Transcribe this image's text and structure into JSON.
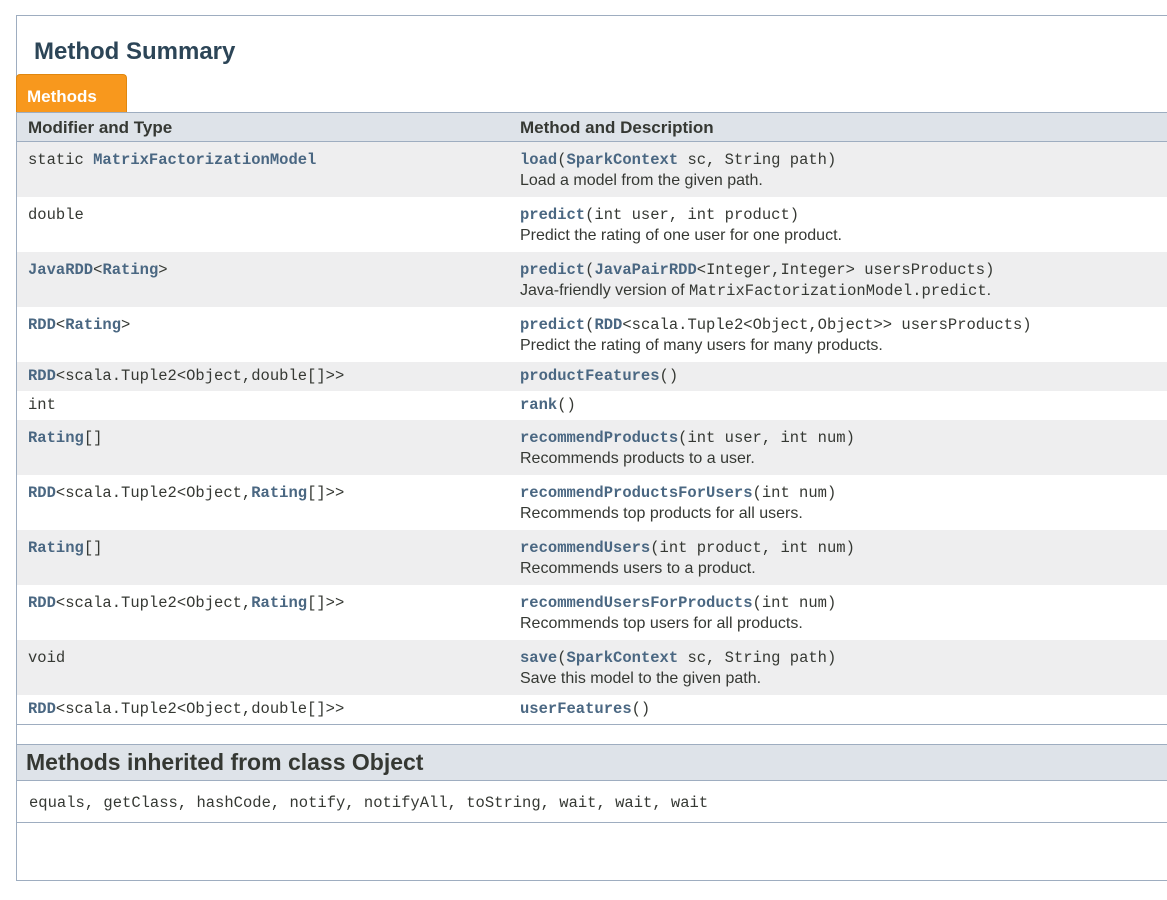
{
  "section_title": "Method Summary",
  "tab_label": "Methods",
  "headers": {
    "modifier": "Modifier and Type",
    "method": "Method and Description"
  },
  "rows": [
    {
      "type": [
        {
          "t": "static ",
          "link": false
        },
        {
          "t": "MatrixFactorizationModel",
          "link": true
        }
      ],
      "sig": [
        {
          "t": "load",
          "link": true
        },
        {
          "t": "(",
          "link": false
        },
        {
          "t": "SparkContext",
          "link": true
        },
        {
          "t": " sc, String path)",
          "link": false
        }
      ],
      "desc": [
        {
          "t": "Load a model from the given path.",
          "code": false
        }
      ]
    },
    {
      "type": [
        {
          "t": "double",
          "link": false
        }
      ],
      "sig": [
        {
          "t": "predict",
          "link": true
        },
        {
          "t": "(int user, int product)",
          "link": false
        }
      ],
      "desc": [
        {
          "t": "Predict the rating of one user for one product.",
          "code": false
        }
      ]
    },
    {
      "type": [
        {
          "t": "JavaRDD",
          "link": true
        },
        {
          "t": "<",
          "link": false
        },
        {
          "t": "Rating",
          "link": true
        },
        {
          "t": ">",
          "link": false
        }
      ],
      "sig": [
        {
          "t": "predict",
          "link": true
        },
        {
          "t": "(",
          "link": false
        },
        {
          "t": "JavaPairRDD",
          "link": true
        },
        {
          "t": "<Integer,Integer> usersProducts)",
          "link": false
        }
      ],
      "desc": [
        {
          "t": "Java-friendly version of ",
          "code": false
        },
        {
          "t": "MatrixFactorizationModel.predict",
          "code": true
        },
        {
          "t": ".",
          "code": false
        }
      ]
    },
    {
      "type": [
        {
          "t": "RDD",
          "link": true
        },
        {
          "t": "<",
          "link": false
        },
        {
          "t": "Rating",
          "link": true
        },
        {
          "t": ">",
          "link": false
        }
      ],
      "sig": [
        {
          "t": "predict",
          "link": true
        },
        {
          "t": "(",
          "link": false
        },
        {
          "t": "RDD",
          "link": true
        },
        {
          "t": "<scala.Tuple2<Object,Object>> usersProducts)",
          "link": false
        }
      ],
      "desc": [
        {
          "t": "Predict the rating of many users for many products.",
          "code": false
        }
      ]
    },
    {
      "type": [
        {
          "t": "RDD",
          "link": true
        },
        {
          "t": "<scala.Tuple2<Object,double[]>>",
          "link": false
        }
      ],
      "sig": [
        {
          "t": "productFeatures",
          "link": true
        },
        {
          "t": "()",
          "link": false
        }
      ],
      "desc": []
    },
    {
      "type": [
        {
          "t": "int",
          "link": false
        }
      ],
      "sig": [
        {
          "t": "rank",
          "link": true
        },
        {
          "t": "()",
          "link": false
        }
      ],
      "desc": []
    },
    {
      "type": [
        {
          "t": "Rating",
          "link": true
        },
        {
          "t": "[]",
          "link": false
        }
      ],
      "sig": [
        {
          "t": "recommendProducts",
          "link": true
        },
        {
          "t": "(int user, int num)",
          "link": false
        }
      ],
      "desc": [
        {
          "t": "Recommends products to a user.",
          "code": false
        }
      ]
    },
    {
      "type": [
        {
          "t": "RDD",
          "link": true
        },
        {
          "t": "<scala.Tuple2<Object,",
          "link": false
        },
        {
          "t": "Rating",
          "link": true
        },
        {
          "t": "[]>>",
          "link": false
        }
      ],
      "sig": [
        {
          "t": "recommendProductsForUsers",
          "link": true
        },
        {
          "t": "(int num)",
          "link": false
        }
      ],
      "desc": [
        {
          "t": "Recommends top products for all users.",
          "code": false
        }
      ]
    },
    {
      "type": [
        {
          "t": "Rating",
          "link": true
        },
        {
          "t": "[]",
          "link": false
        }
      ],
      "sig": [
        {
          "t": "recommendUsers",
          "link": true
        },
        {
          "t": "(int product, int num)",
          "link": false
        }
      ],
      "desc": [
        {
          "t": "Recommends users to a product.",
          "code": false
        }
      ]
    },
    {
      "type": [
        {
          "t": "RDD",
          "link": true
        },
        {
          "t": "<scala.Tuple2<Object,",
          "link": false
        },
        {
          "t": "Rating",
          "link": true
        },
        {
          "t": "[]>>",
          "link": false
        }
      ],
      "sig": [
        {
          "t": "recommendUsersForProducts",
          "link": true
        },
        {
          "t": "(int num)",
          "link": false
        }
      ],
      "desc": [
        {
          "t": "Recommends top users for all products.",
          "code": false
        }
      ]
    },
    {
      "type": [
        {
          "t": "void",
          "link": false
        }
      ],
      "sig": [
        {
          "t": "save",
          "link": true
        },
        {
          "t": "(",
          "link": false
        },
        {
          "t": "SparkContext",
          "link": true
        },
        {
          "t": " sc, String path)",
          "link": false
        }
      ],
      "desc": [
        {
          "t": "Save this model to the given path.",
          "code": false
        }
      ]
    },
    {
      "type": [
        {
          "t": "RDD",
          "link": true
        },
        {
          "t": "<scala.Tuple2<Object,double[]>>",
          "link": false
        }
      ],
      "sig": [
        {
          "t": "userFeatures",
          "link": true
        },
        {
          "t": "()",
          "link": false
        }
      ],
      "desc": []
    }
  ],
  "inherited": {
    "title": "Methods inherited from class Object",
    "methods": [
      "equals",
      "getClass",
      "hashCode",
      "notify",
      "notifyAll",
      "toString",
      "wait",
      "wait",
      "wait"
    ]
  },
  "colors": {
    "accent_tab": "#f8981d",
    "link": "#4a6782",
    "header_bg": "#dee3e9",
    "alt_row_bg": "#eeeeef",
    "title": "#2c4557"
  }
}
